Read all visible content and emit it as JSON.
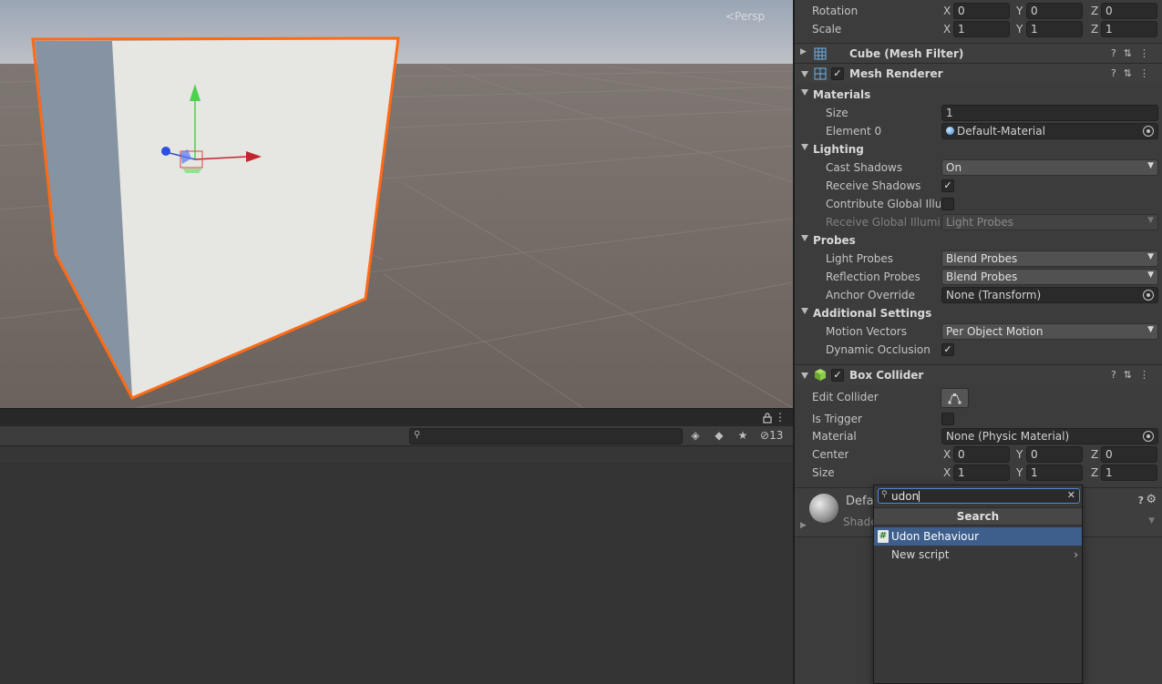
{
  "scene": {
    "camera_label": "Persp"
  },
  "project_panel": {
    "hidden_count": "13",
    "search_placeholder": ""
  },
  "inspector": {
    "transform": {
      "rotation_label": "Rotation",
      "rotation": {
        "x": "0",
        "y": "0",
        "z": "0"
      },
      "scale_label": "Scale",
      "scale": {
        "x": "1",
        "y": "1",
        "z": "1"
      }
    },
    "mesh_filter": {
      "title": "Cube (Mesh Filter)"
    },
    "mesh_renderer": {
      "title": "Mesh Renderer",
      "enabled": true,
      "materials_label": "Materials",
      "size_label": "Size",
      "size_value": "1",
      "element0_label": "Element 0",
      "element0_value": "Default-Material",
      "lighting_label": "Lighting",
      "cast_shadows_label": "Cast Shadows",
      "cast_shadows_value": "On",
      "receive_shadows_label": "Receive Shadows",
      "receive_shadows": true,
      "contribute_gi_label": "Contribute Global Illum",
      "contribute_gi": false,
      "receive_gi_label": "Receive Global Illumina",
      "receive_gi_value": "Light Probes",
      "probes_label": "Probes",
      "light_probes_label": "Light Probes",
      "light_probes_value": "Blend Probes",
      "reflection_probes_label": "Reflection Probes",
      "reflection_probes_value": "Blend Probes",
      "anchor_override_label": "Anchor Override",
      "anchor_override_value": "None (Transform)",
      "additional_label": "Additional Settings",
      "motion_vectors_label": "Motion Vectors",
      "motion_vectors_value": "Per Object Motion",
      "dynamic_occlusion_label": "Dynamic Occlusion",
      "dynamic_occlusion": true
    },
    "box_collider": {
      "title": "Box Collider",
      "enabled": true,
      "edit_collider_label": "Edit Collider",
      "is_trigger_label": "Is Trigger",
      "is_trigger": false,
      "material_label": "Material",
      "material_value": "None (Physic Material)",
      "center_label": "Center",
      "center": {
        "x": "0",
        "y": "0",
        "z": "0"
      },
      "size_label": "Size",
      "size": {
        "x": "1",
        "y": "1",
        "z": "1"
      }
    },
    "material_preview": {
      "name_partial": "Defa",
      "shader_partial": "Shade"
    },
    "axis_labels": {
      "x": "X",
      "y": "Y",
      "z": "Z"
    },
    "checkmark": "✓"
  },
  "add_component_popup": {
    "search_value": "udon",
    "header": "Search",
    "items": [
      {
        "label": "Udon Behaviour",
        "selected": true
      },
      {
        "label": "New script",
        "selected": false
      }
    ]
  },
  "colors": {
    "selection_outline": "#ff6a14",
    "popup_selected": "#3e5e8c",
    "gizmo_x": "#c0272d",
    "gizmo_y": "#4fd14f",
    "gizmo_z": "#2d4fe0"
  }
}
